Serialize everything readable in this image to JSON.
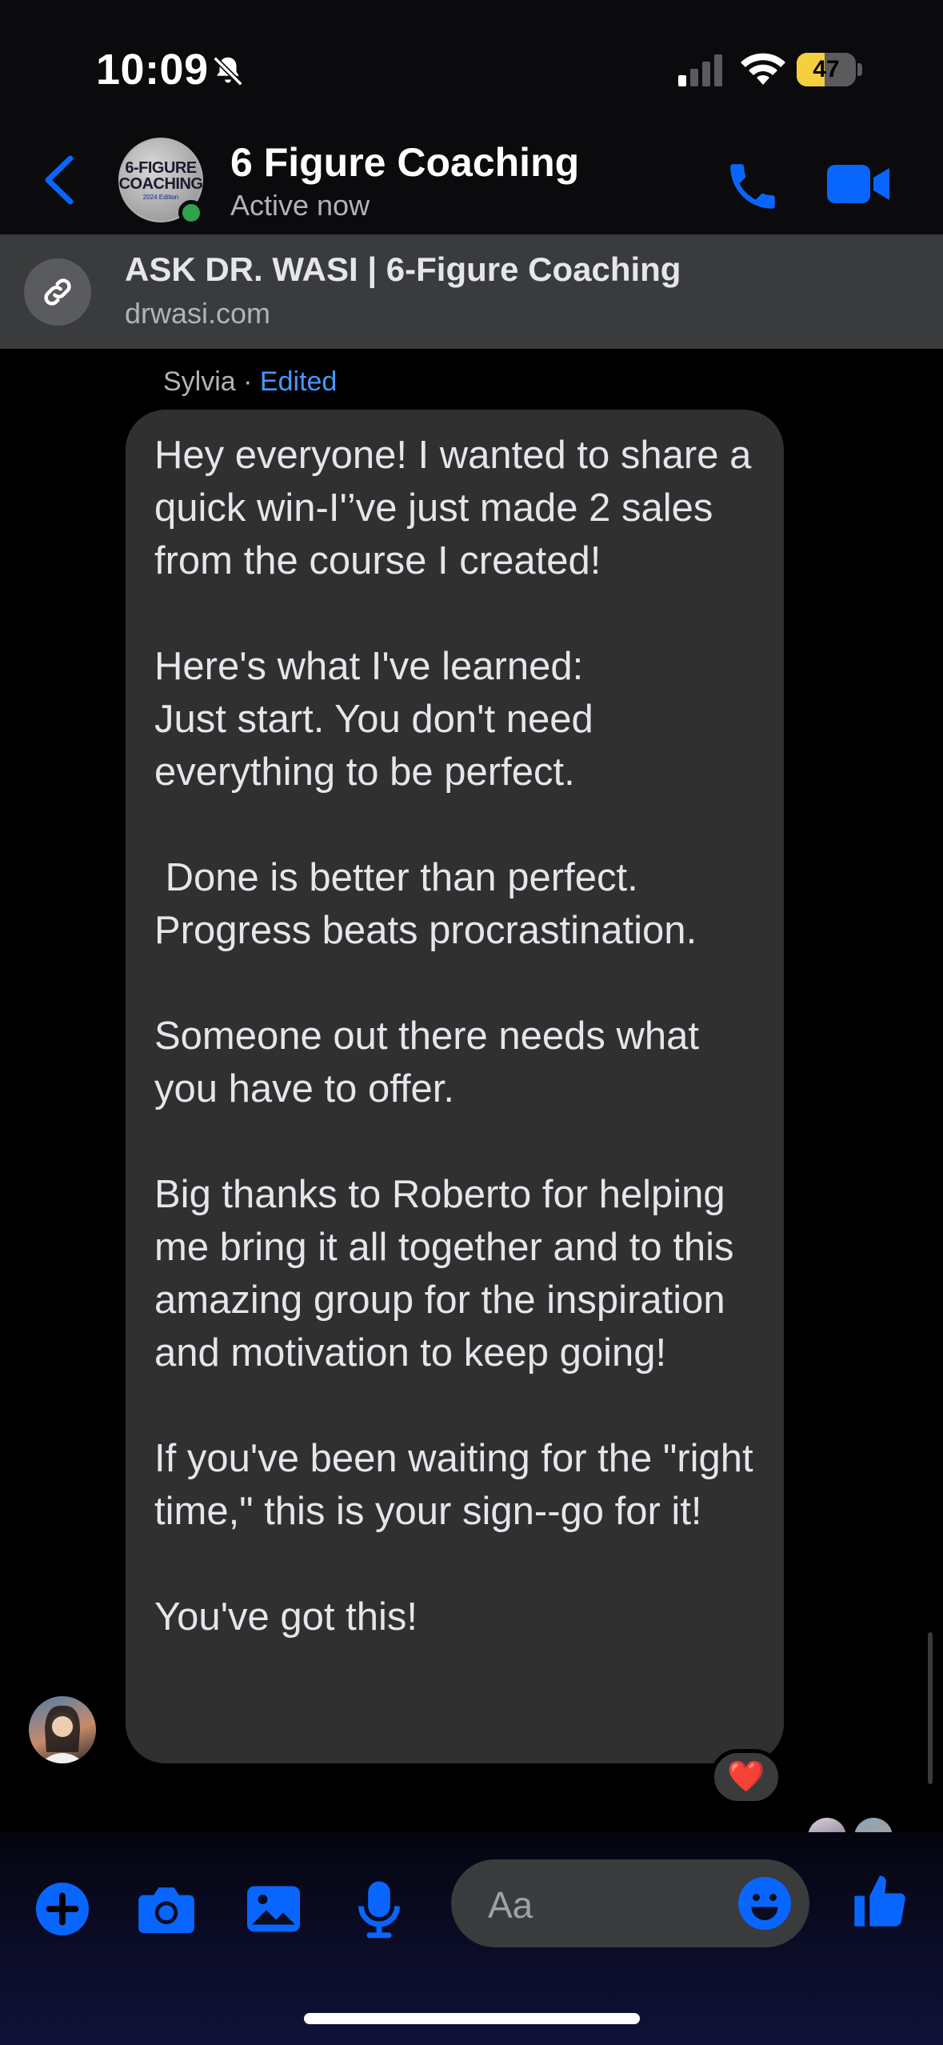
{
  "status_bar": {
    "time": "10:09",
    "battery_level": "47",
    "icons": [
      "bell-slash-icon",
      "cellular-signal-icon",
      "wifi-icon",
      "battery-icon"
    ]
  },
  "header": {
    "title": "6 Figure Coaching",
    "status": "Active now",
    "avatar_text_line1": "6-FIGURE",
    "avatar_text_line2": "COACHING",
    "avatar_text_line3": "2024 Edition"
  },
  "pinned": {
    "title": "ASK DR. WASI | 6-Figure Coaching",
    "url": "drwasi.com"
  },
  "message": {
    "sender": "Sylvia",
    "separator": " · ",
    "edited_label": "Edited",
    "text": "Hey everyone! I wanted to share a quick win-I'’ve just made 2 sales from the course I created!\n\nHere's what I've learned:\nJust start. You don't need everything to be perfect.\n\n Done is better than perfect. Progress beats procrastination.\n\nSomeone out there needs what you have to offer.\n\nBig thanks to Roberto for helping me bring it all together and to this amazing group for the inspiration and motivation to keep going!\n\nIf you've been waiting for the \"right time,\" this is your sign--go for it!\n\nYou've got this!",
    "reaction": "❤️"
  },
  "composer": {
    "placeholder": "Aa",
    "buttons": [
      "plus-icon",
      "camera-icon",
      "gallery-icon",
      "microphone-icon",
      "emoji-icon",
      "thumbs-up-icon"
    ]
  },
  "colors": {
    "accent": "#0866ff",
    "bubble": "#303030",
    "header_bg": "#0b0b0d",
    "pinned_bg": "#3a3b3c",
    "online": "#31a24c",
    "battery": "#f4d03f"
  }
}
